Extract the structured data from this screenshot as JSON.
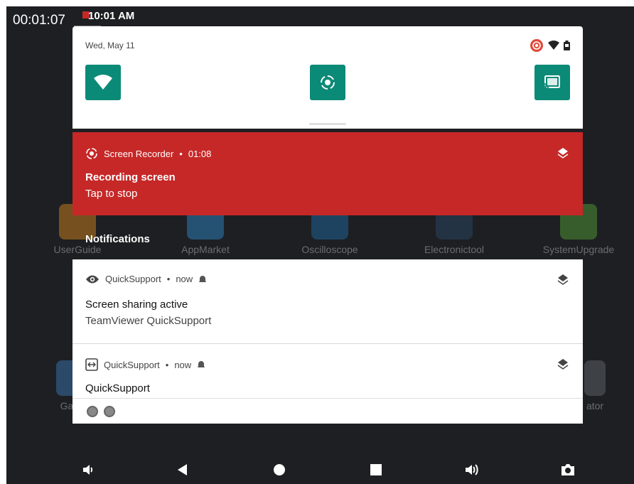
{
  "overlay": {
    "timer": "00:01:07",
    "clock": "10:01 AM"
  },
  "home_apps": [
    {
      "label": "UserGuide",
      "color": "#e38b1d"
    },
    {
      "label": "AppMarket",
      "color": "#2f8fd8"
    },
    {
      "label": "Oscilloscope",
      "color": "#1f6fb0"
    },
    {
      "label": "Electronictool",
      "color": "#2a4b6e"
    },
    {
      "label": "SystemUpgrade",
      "color": "#58a83a"
    },
    {
      "label": "Ga",
      "color": "#3b7fc4"
    },
    {
      "label": "ator",
      "color": "#666a70"
    }
  ],
  "quick_settings": {
    "date": "Wed, May 11",
    "tiles": [
      {
        "icon": "wifi-icon"
      },
      {
        "icon": "screen-record-icon"
      },
      {
        "icon": "cast-icon"
      }
    ],
    "tile_color": "#0b8a77"
  },
  "recorder": {
    "app": "Screen Recorder",
    "separator": "•",
    "time": "01:08",
    "title": "Recording screen",
    "subtitle": "Tap to stop",
    "color": "#c62828"
  },
  "notifications_header": "Notifications",
  "notifications": [
    {
      "app": "QuickSupport",
      "separator": "•",
      "time": "now",
      "title": "Screen sharing active",
      "subtitle": "TeamViewer QuickSupport",
      "icon": "eye-icon"
    },
    {
      "app": "QuickSupport",
      "separator": "•",
      "time": "now",
      "title": "QuickSupport",
      "icon": "teamviewer-icon"
    }
  ]
}
